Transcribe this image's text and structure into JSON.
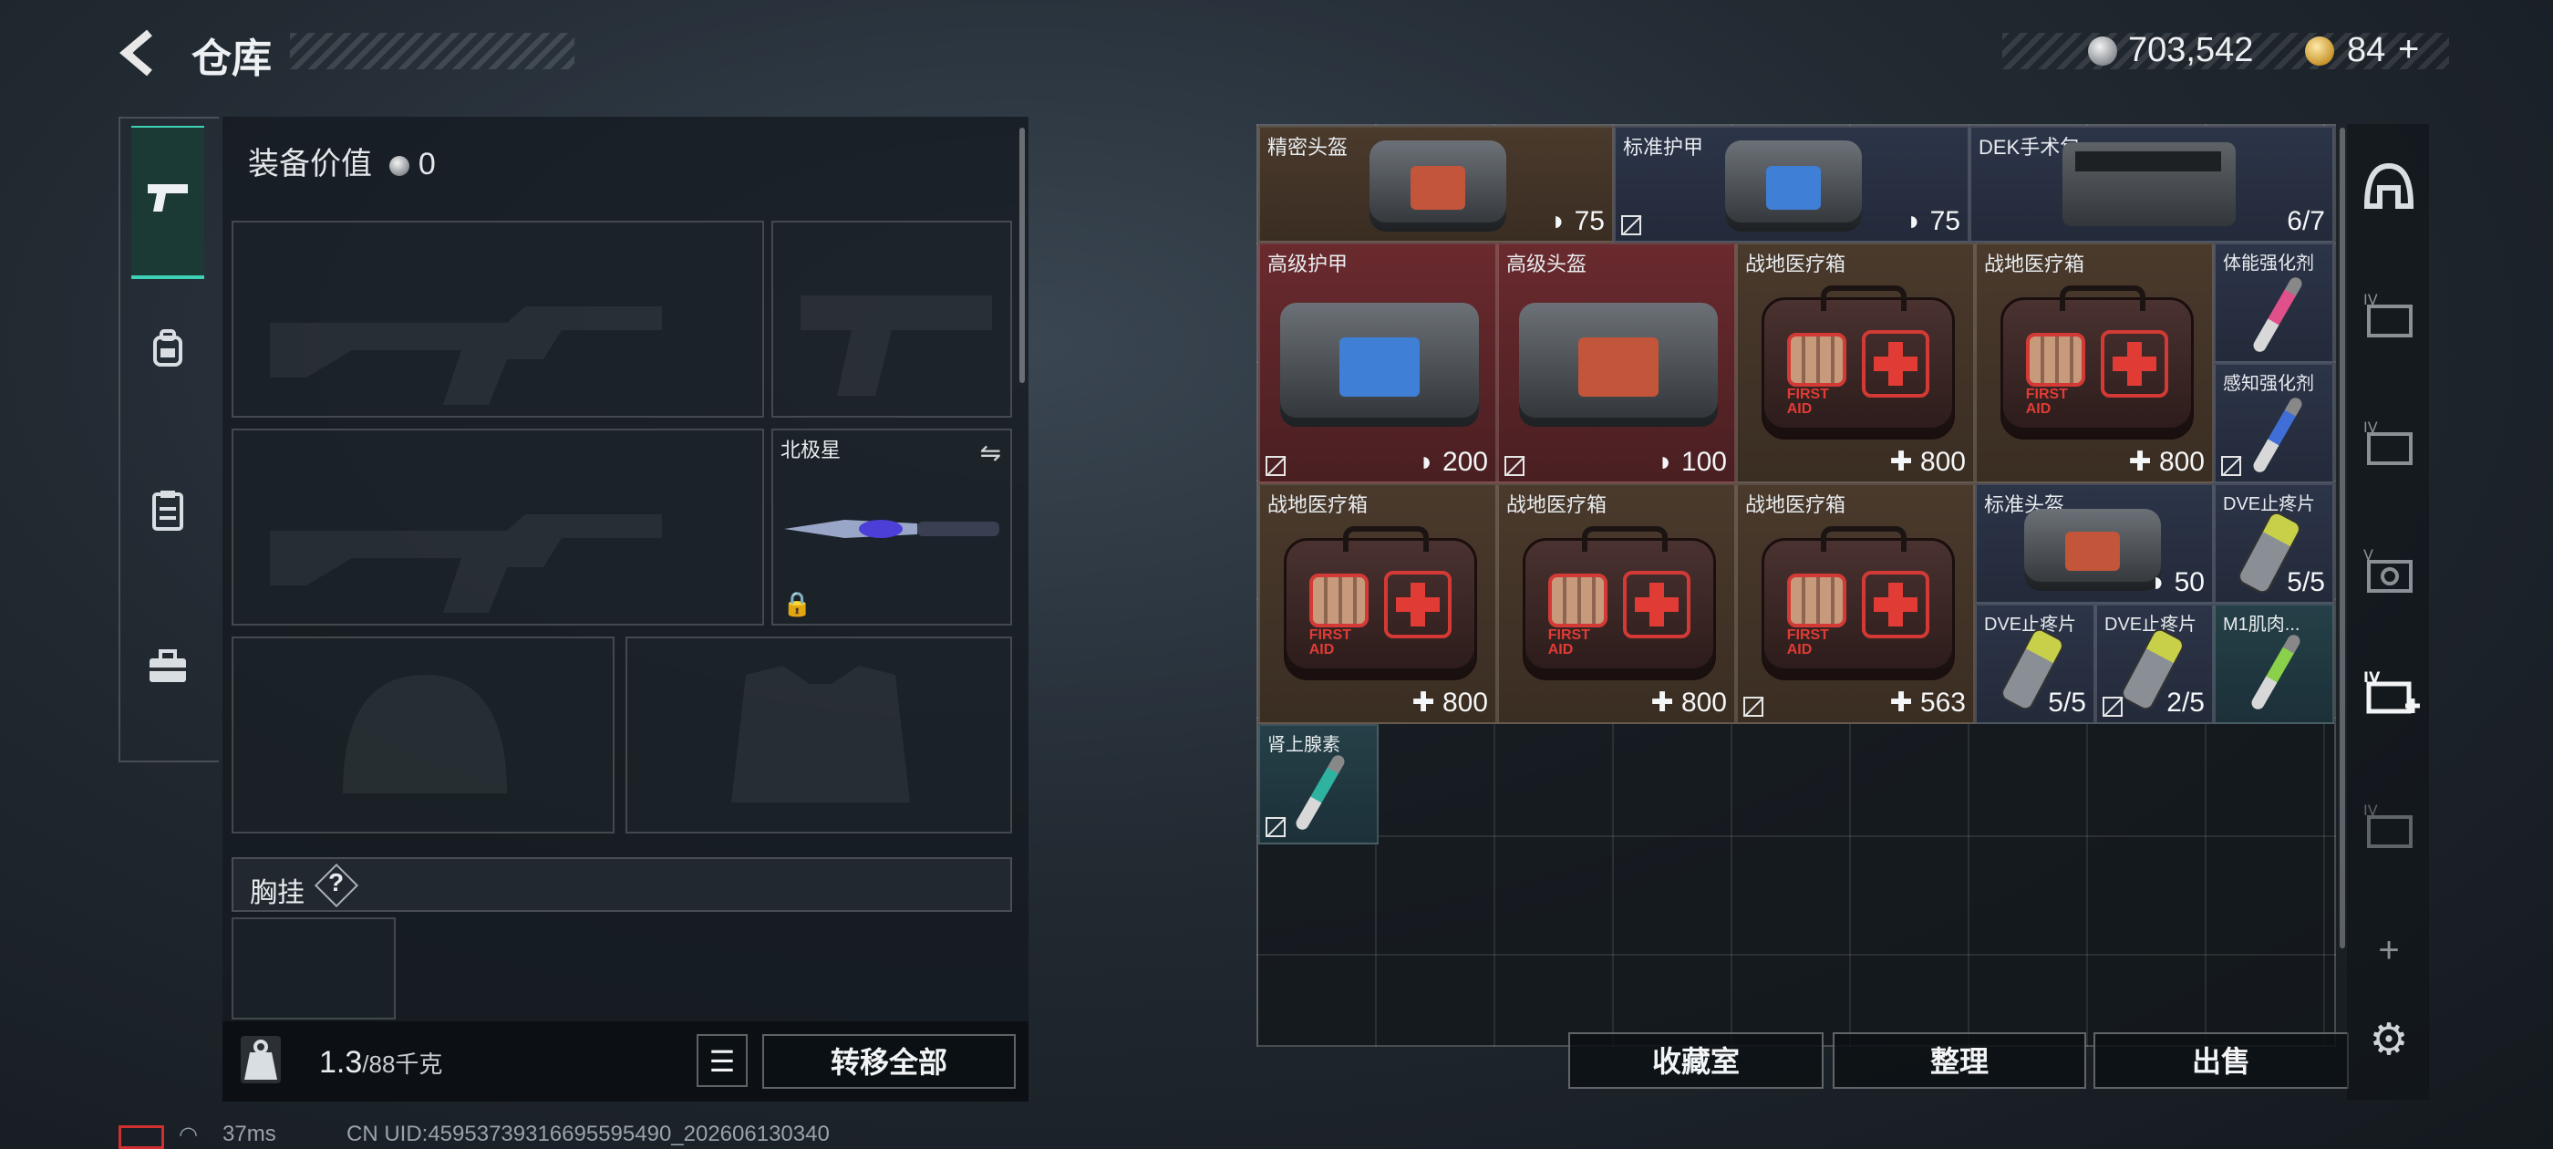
{
  "header": {
    "title": "仓库",
    "silver": "703,542",
    "gold": "84",
    "gold_plus": "+"
  },
  "left_tabs": [
    "pistol-icon",
    "backpack-icon",
    "clipboard-icon",
    "toolbox-icon"
  ],
  "equipment": {
    "value_label": "装备价值",
    "value": "0",
    "melee_name": "北极星",
    "chest_label": "胸挂",
    "chest_help": "?",
    "weight_current": "1.3",
    "weight_max": "/88千克",
    "transfer_all": "转移全部"
  },
  "items": [
    {
      "name": "精密头盔",
      "value": "75",
      "value_icon": "shield-icon",
      "bg": "brown"
    },
    {
      "name": "标准护甲",
      "value": "75",
      "value_icon": "shield-icon",
      "bg": "blue",
      "no_trade": true
    },
    {
      "name": "DEK手术包",
      "value": "6/7",
      "bg": "blue"
    },
    {
      "name": "高级护甲",
      "value": "200",
      "value_icon": "shield-icon",
      "bg": "red",
      "no_trade": true
    },
    {
      "name": "高级头盔",
      "value": "100",
      "value_icon": "shield-icon",
      "bg": "red",
      "no_trade": true
    },
    {
      "name": "战地医疗箱",
      "value": "800",
      "value_icon": "plus-icon",
      "bg": "brown"
    },
    {
      "name": "战地医疗箱",
      "value": "800",
      "value_icon": "plus-icon",
      "bg": "brown"
    },
    {
      "name": "体能强化剂",
      "value": "",
      "bg": "blue"
    },
    {
      "name": "感知强化剂",
      "value": "",
      "bg": "blue",
      "no_trade": true
    },
    {
      "name": "战地医疗箱",
      "value": "800",
      "value_icon": "plus-icon",
      "bg": "brown"
    },
    {
      "name": "战地医疗箱",
      "value": "800",
      "value_icon": "plus-icon",
      "bg": "brown"
    },
    {
      "name": "战地医疗箱",
      "value": "563",
      "value_icon": "plus-icon",
      "bg": "brown",
      "no_trade": true
    },
    {
      "name": "标准头盔",
      "value": "50",
      "value_icon": "shield-icon",
      "bg": "blue"
    },
    {
      "name": "DVE止疼片",
      "value": "5/5",
      "bg": "blue"
    },
    {
      "name": "DVE止疼片",
      "value": "5/5",
      "bg": "blue"
    },
    {
      "name": "DVE止疼片",
      "value": "2/5",
      "bg": "blue",
      "no_trade": true
    },
    {
      "name": "M1肌肉...",
      "value": "",
      "bg": "teal"
    },
    {
      "name": "肾上腺素",
      "value": "",
      "bg": "teal",
      "no_trade": true
    }
  ],
  "actions": {
    "collection": "收藏室",
    "sort": "整理",
    "sell": "出售"
  },
  "sidebar": {
    "plus": "+",
    "icons": [
      "helmet-icon",
      "stash-iv-icon",
      "stash-iv-icon",
      "stash-v-icon",
      "stash-iv-medical-icon",
      "stash-iv-icon",
      "add-icon",
      "settings-icon"
    ]
  },
  "status": {
    "ping": "37ms",
    "uid": "CN UID:45953739316695595490_202606130340"
  }
}
